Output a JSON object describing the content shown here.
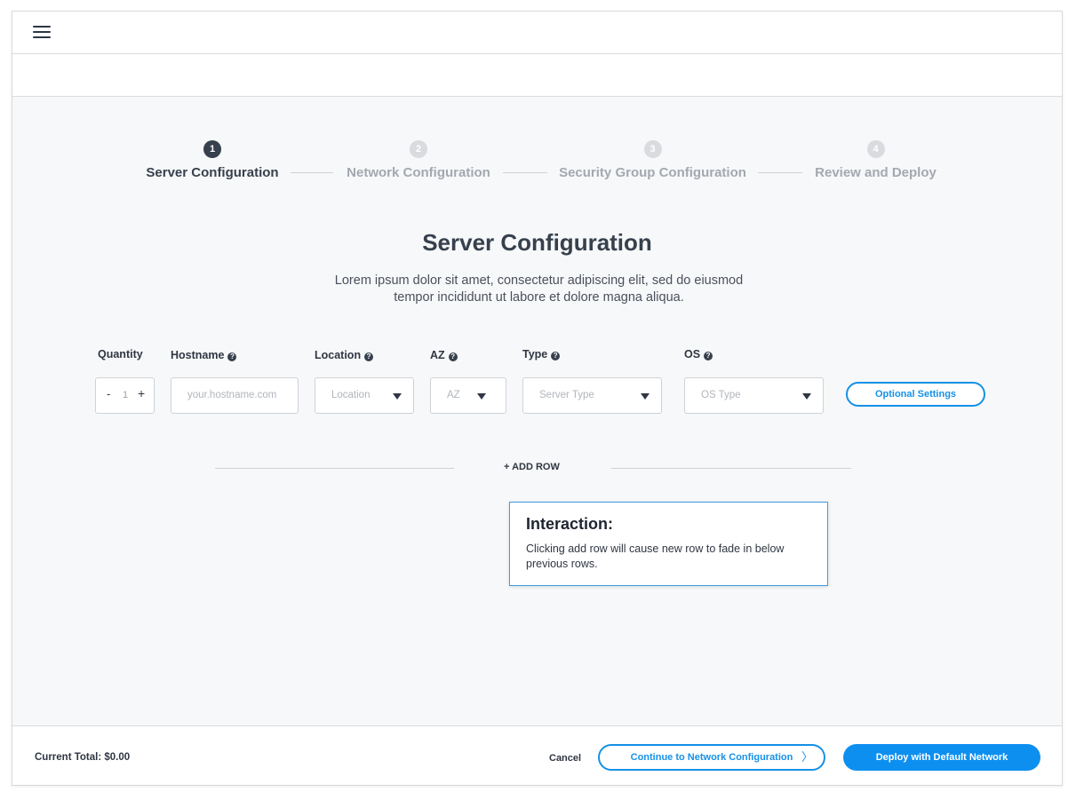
{
  "steps": [
    {
      "number": "1",
      "label": "Server Configuration",
      "active": true
    },
    {
      "number": "2",
      "label": "Network Configuration",
      "active": false
    },
    {
      "number": "3",
      "label": "Security Group Configuration",
      "active": false
    },
    {
      "number": "4",
      "label": "Review and Deploy",
      "active": false
    }
  ],
  "main": {
    "title": "Server Configuration",
    "description": "Lorem ipsum dolor sit amet, consectetur adipiscing elit, sed do eiusmod tempor incididunt ut labore et dolore magna aliqua."
  },
  "columns": {
    "quantity": "Quantity",
    "hostname": "Hostname",
    "location": "Location",
    "az": "AZ",
    "type": "Type",
    "os": "OS"
  },
  "help_glyph": "?",
  "row": {
    "quantity_minus": "-",
    "quantity_value": "1",
    "quantity_plus": "+",
    "hostname_placeholder": "your.hostname.com",
    "location_placeholder": "Location",
    "az_placeholder": "AZ",
    "type_placeholder": "Server Type",
    "os_placeholder": "OS Type",
    "optional_settings": "Optional Settings"
  },
  "add_row": "+ ADD ROW",
  "note": {
    "title": "Interaction:",
    "body": "Clicking add row will cause new row to fade in below previous rows."
  },
  "footer": {
    "current_total": "Current Total: $0.00",
    "cancel": "Cancel",
    "continue": "Continue to Network Configuration",
    "continue_chevron": "〉",
    "deploy": "Deploy with Default Network"
  },
  "colors": {
    "accent": "#1691e6",
    "primary_button": "#0d8ff0",
    "active_step": "#37404d",
    "inactive_step": "#d9dbdf"
  }
}
